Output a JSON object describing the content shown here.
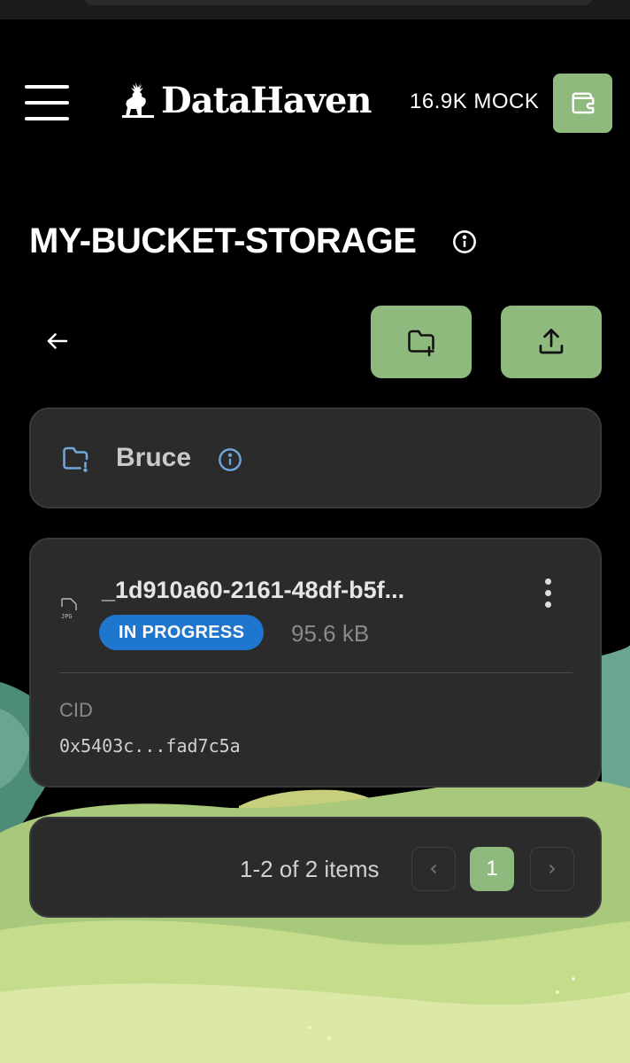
{
  "app": {
    "name": "DataHaven",
    "balance": "16.9K MOCK"
  },
  "colors": {
    "accent": "#8fba7e",
    "badge_in_progress": "#1f76cf",
    "card_bg": "#2b2b2b",
    "background": "#000000"
  },
  "header": {
    "menu_icon": "hamburger-menu-icon",
    "logo_icon": "stag-icon",
    "wallet_icon": "wallet-icon"
  },
  "page": {
    "title": "MY-BUCKET-STORAGE",
    "title_icon": "info-icon"
  },
  "actions": {
    "back_icon": "arrow-left-icon",
    "new_folder_icon": "folder-plus-icon",
    "upload_icon": "upload-icon"
  },
  "items": [
    {
      "type": "folder",
      "name": "Bruce",
      "icon": "folder-icon"
    },
    {
      "type": "file",
      "name": "_1d910a60-2161-48df-b5f...",
      "file_type": "JPG",
      "status": "IN PROGRESS",
      "size": "95.6 kB",
      "cid_label": "CID",
      "cid": "0x5403c...fad7c5a"
    }
  ],
  "pagination": {
    "summary": "1-2 of 2 items",
    "current_page": "1"
  }
}
